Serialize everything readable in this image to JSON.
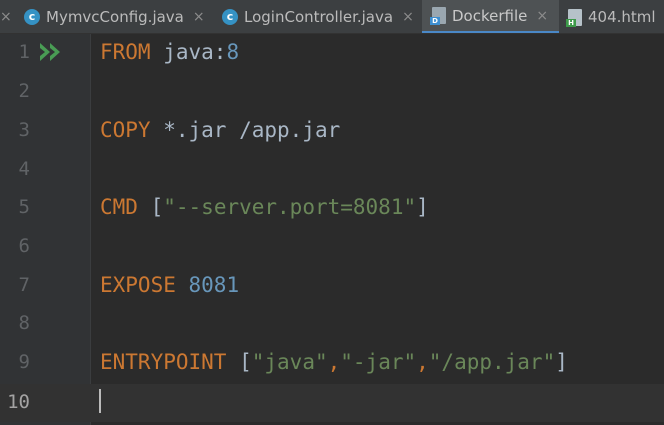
{
  "tabs": [
    {
      "label": "MymvcConfig.java",
      "icon": "java-class-icon",
      "active": false
    },
    {
      "label": "LoginController.java",
      "icon": "java-class-icon",
      "active": false
    },
    {
      "label": "Dockerfile",
      "icon": "dockerfile-icon",
      "active": true
    },
    {
      "label": "404.html",
      "icon": "html-file-icon",
      "active": false
    }
  ],
  "tab_close_glyph": "×",
  "icon_glyphs": {
    "java_class": "c",
    "docker_badge": "D",
    "html_badge": "H"
  },
  "gutter": {
    "line_numbers": [
      "1",
      "2",
      "3",
      "4",
      "5",
      "6",
      "7",
      "8",
      "9",
      "10"
    ],
    "current_line": "10"
  },
  "code": {
    "line1": {
      "keyword": "FROM",
      "image": "java:",
      "tag": "8"
    },
    "line3": {
      "keyword": "COPY",
      "args": "*.jar /app.jar"
    },
    "line5": {
      "keyword": "CMD",
      "open": "[",
      "arg": "\"--server.port=8081\"",
      "close": "]"
    },
    "line7": {
      "keyword": "EXPOSE",
      "port": "8081"
    },
    "line9": {
      "keyword": "ENTRYPOINT",
      "open": "[",
      "arg1": "\"java\"",
      "sep1": ",",
      "arg2": "\"-jar\"",
      "sep2": ",",
      "arg3": "\"/app.jar\"",
      "close": "]"
    }
  },
  "colors": {
    "keyword": "#cc7832",
    "number": "#6897bb",
    "string": "#6a8759",
    "text": "#a9b7c6",
    "run_arrow": "#499c54",
    "tab_underline": "#4a88c7"
  }
}
